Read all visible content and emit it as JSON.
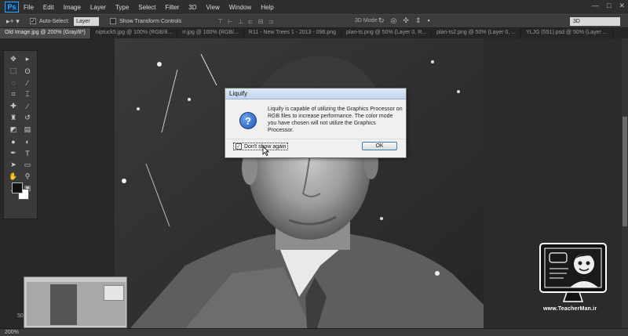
{
  "app": {
    "logo_text": "Ps"
  },
  "menu": {
    "items": [
      "File",
      "Edit",
      "Image",
      "Layer",
      "Type",
      "Select",
      "Filter",
      "3D",
      "View",
      "Window",
      "Help"
    ]
  },
  "window_controls": {
    "minimize": "—",
    "maximize": "□",
    "close": "✕"
  },
  "options_bar": {
    "tool_glyph": "▸+ ▾",
    "auto_select_checked": true,
    "auto_select_label": "Auto-Select:",
    "auto_select_value": "Layer",
    "show_transform_checked": false,
    "show_transform_label": "Show Transform Controls",
    "mode_3d_label": "3D Mode:",
    "workspace_value": "3D"
  },
  "tabs": [
    {
      "label": "Old Image.jpg @ 200% (Gray/8*)",
      "active": true
    },
    {
      "label": "niptuck5.jpg @ 100% (RGB/8...",
      "active": false
    },
    {
      "label": "rr.jpg @ 100% (RGB/...",
      "active": false
    },
    {
      "label": "R11 - New Trees 1 - 2013 - 096.png",
      "active": false
    },
    {
      "label": "plan-ts.png @ 50% (Layer 0, R...",
      "active": false
    },
    {
      "label": "plan-ts2.png @ 50% (Layer 0, ...",
      "active": false
    },
    {
      "label": "YLJG (551).psd @ 50% (Layer ...",
      "active": false
    }
  ],
  "tools": [
    {
      "name": "move-tool-icon",
      "glyph": "✥"
    },
    {
      "name": "artboard-tool-icon",
      "glyph": "▸"
    },
    {
      "name": "marquee-tool-icon",
      "glyph": "⬚"
    },
    {
      "name": "lasso-tool-icon",
      "glyph": "ʘ"
    },
    {
      "name": "quick-select-icon",
      "glyph": "◌"
    },
    {
      "name": "eyedropper-icon",
      "glyph": "⁄"
    },
    {
      "name": "crop-tool-icon",
      "glyph": "⌗"
    },
    {
      "name": "slice-tool-icon",
      "glyph": "⌶"
    },
    {
      "name": "healing-brush-icon",
      "glyph": "✚"
    },
    {
      "name": "brush-tool-icon",
      "glyph": "∕"
    },
    {
      "name": "clone-stamp-icon",
      "glyph": "♜"
    },
    {
      "name": "history-brush-icon",
      "glyph": "↺"
    },
    {
      "name": "eraser-tool-icon",
      "glyph": "◩"
    },
    {
      "name": "gradient-tool-icon",
      "glyph": "▤"
    },
    {
      "name": "blur-tool-icon",
      "glyph": "●"
    },
    {
      "name": "dodge-tool-icon",
      "glyph": "◐"
    },
    {
      "name": "pen-tool-icon",
      "glyph": "✒"
    },
    {
      "name": "type-tool-icon",
      "glyph": "T"
    },
    {
      "name": "path-select-icon",
      "glyph": "➤"
    },
    {
      "name": "shape-tool-icon",
      "glyph": "▭"
    },
    {
      "name": "hand-tool-icon",
      "glyph": "✋"
    },
    {
      "name": "zoom-tool-icon",
      "glyph": "⚲"
    },
    {
      "name": "edit-toolbar-icon",
      "glyph": "…"
    },
    {
      "name": "screen-mode-icon",
      "glyph": "▣"
    }
  ],
  "colors": {
    "foreground": "#101010",
    "background": "#ffffff",
    "dialog_accent": "#3c7fb1"
  },
  "dialog": {
    "title": "Liquify",
    "icon": "?",
    "message": "Liquify is capable of utilizing the Graphics Processor on RGB files to increase performance. The color mode you have chosen will not utilize the Graphics Processor.",
    "checkbox_checked": true,
    "checkbox_label": "Don't show again",
    "ok_label": "OK"
  },
  "status": {
    "zoom": "200%",
    "side_zoom": "50"
  },
  "watermark": {
    "url": "www.TeacherMan.ir"
  }
}
